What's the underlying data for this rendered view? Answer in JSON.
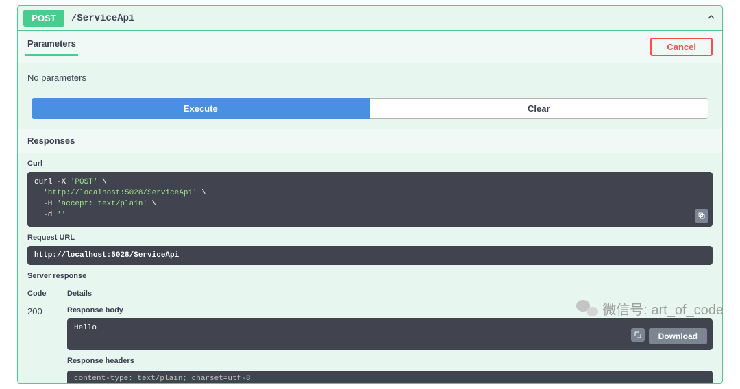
{
  "operation": {
    "method": "POST",
    "path": "/ServiceApi"
  },
  "parameters": {
    "title": "Parameters",
    "cancel_label": "Cancel",
    "no_params_text": "No parameters",
    "execute_label": "Execute",
    "clear_label": "Clear"
  },
  "responses": {
    "title": "Responses",
    "curl_label": "Curl",
    "curl_lines": {
      "l1a": "curl -X ",
      "l1b": "'POST'",
      "l1c": " \\",
      "l2a": "  'http://localhost:5028/ServiceApi'",
      "l2b": " \\",
      "l3a": "  -H ",
      "l3b": "'accept: text/plain'",
      "l3c": " \\",
      "l4a": "  -d ",
      "l4b": "''"
    },
    "request_url_label": "Request URL",
    "request_url": "http://localhost:5028/ServiceApi",
    "server_response_label": "Server response",
    "code_header": "Code",
    "details_header": "Details",
    "status_code": "200",
    "response_body_label": "Response body",
    "response_body": "Hello",
    "download_label": "Download",
    "response_headers_label": "Response headers",
    "response_headers_line": " content-type: text/plain; charset=utf-8 "
  },
  "watermark": {
    "text": "微信号: art_of_code"
  }
}
